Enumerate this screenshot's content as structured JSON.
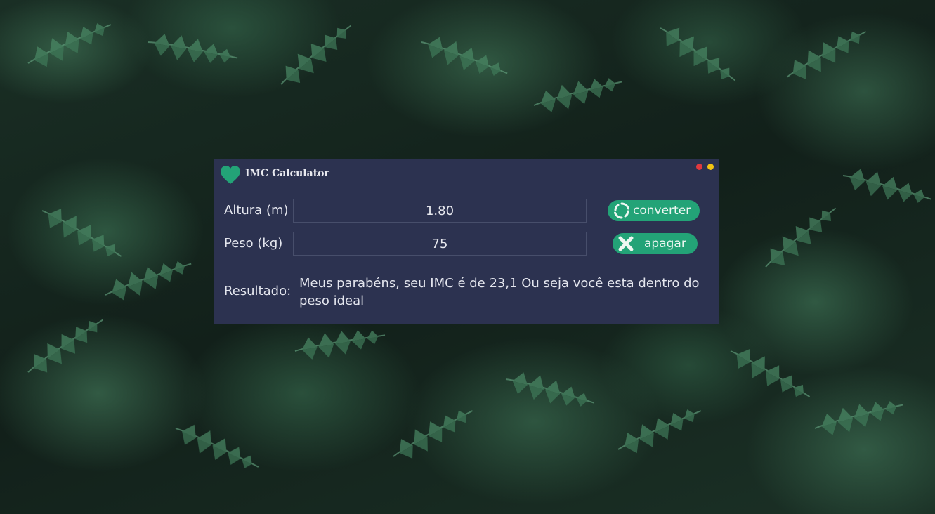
{
  "window": {
    "title": "IMC Calculator",
    "app_icon": "heart-icon"
  },
  "controls": {
    "close_icon": "close-dot-icon",
    "minimize_icon": "minimize-dot-icon"
  },
  "form": {
    "height_label": "Altura (m)",
    "height_value": "1.80",
    "weight_label": "Peso (kg)",
    "weight_value": "75"
  },
  "buttons": {
    "convert_label": "converter",
    "convert_icon": "refresh-icon",
    "clear_label": "apagar",
    "clear_icon": "x-icon"
  },
  "result": {
    "label": "Resultado:",
    "text": "Meus parabéns, seu IMC é de 23,1 Ou seja você esta dentro do peso ideal"
  },
  "colors": {
    "window_bg": "#2c3250",
    "accent": "#23a377",
    "close_dot": "#e0393e",
    "minimize_dot": "#f2c312",
    "background_foliage": "#1b3126"
  }
}
